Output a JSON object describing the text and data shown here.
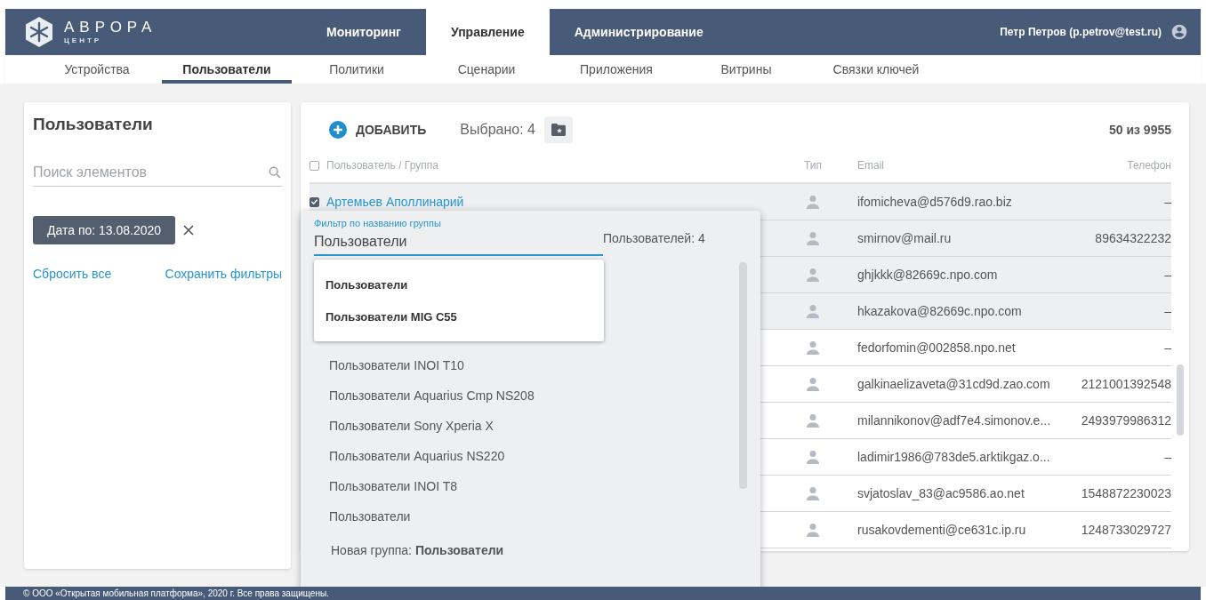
{
  "logo": {
    "title": "АВРОРА",
    "subtitle": "ЦЕНТР"
  },
  "nav": [
    {
      "label": "Мониторинг",
      "selected": false
    },
    {
      "label": "Управление",
      "selected": true
    },
    {
      "label": "Администрирование",
      "selected": false
    }
  ],
  "user": "Петр Петров (p.petrov@test.ru)",
  "subnav": [
    {
      "label": "Устройства",
      "selected": false
    },
    {
      "label": "Пользователи",
      "selected": true
    },
    {
      "label": "Политики",
      "selected": false
    },
    {
      "label": "Сценарии",
      "selected": false
    },
    {
      "label": "Приложения",
      "selected": false
    },
    {
      "label": "Витрины",
      "selected": false
    },
    {
      "label": "Связки ключей",
      "selected": false
    }
  ],
  "filters": {
    "title": "Пользователи",
    "search_placeholder": "Поиск элементов",
    "chip": "Дата по: 13.08.2020",
    "reset": "Сбросить все",
    "save": "Сохранить фильтры"
  },
  "toolbar": {
    "add": "ДОБАВИТЬ",
    "selected_count": "Выбрано: 4",
    "total": "50 из 9955"
  },
  "table": {
    "header_checked": false,
    "columns": [
      "Пользователь / Группа",
      "Тип",
      "Email",
      "Телефон"
    ],
    "rows": [
      {
        "selected": true,
        "name": "Артемьев Аполлинарий",
        "email": "ifomicheva@d576d9.rao.biz",
        "phone": "–"
      },
      {
        "selected": true,
        "email": "smirnov@mail.ru",
        "phone": "89634322232"
      },
      {
        "selected": true,
        "email": "ghjkkk@82669c.npo.com",
        "phone": "–"
      },
      {
        "selected": true,
        "email": "hkazakova@82669c.npo.com",
        "phone": "–"
      },
      {
        "selected": false,
        "email": "fedorfomin@002858.npo.net",
        "phone": "–"
      },
      {
        "selected": false,
        "email": "galkinaelizaveta@31cd9d.zao.com",
        "phone": "2121001392548"
      },
      {
        "selected": false,
        "email": "milannikonov@adf7e4.simonov.e...",
        "phone": "2493979986312"
      },
      {
        "selected": false,
        "email": "ladimir1986@783de5.arktikgaz.o...",
        "phone": "–"
      },
      {
        "selected": false,
        "email": "svjatoslav_83@ac9586.ao.net",
        "phone": "1548872230023"
      },
      {
        "selected": false,
        "email": "rusakovdementi@ce631c.ip.ru",
        "phone": "1248733029727"
      }
    ]
  },
  "group_popup": {
    "field_label": "Фильтр по названию группы",
    "field_value": "Пользователи",
    "count": "Пользователей: 4",
    "suggestions": [
      "Пользователи",
      "Пользователи MIG C55"
    ],
    "groups": [
      "Пользователи INOI T10",
      "Пользователи Aquarius Cmp NS208",
      "Пользователи Sony Xperia X",
      "Пользователи Aquarius NS220",
      "Пользователи INOI T8",
      "Пользователи"
    ],
    "new_group": "Новая группа: **Пользователи**"
  },
  "footer": "© ООО «Открытая мобильная платформа», 2020 г. Все права защищены."
}
